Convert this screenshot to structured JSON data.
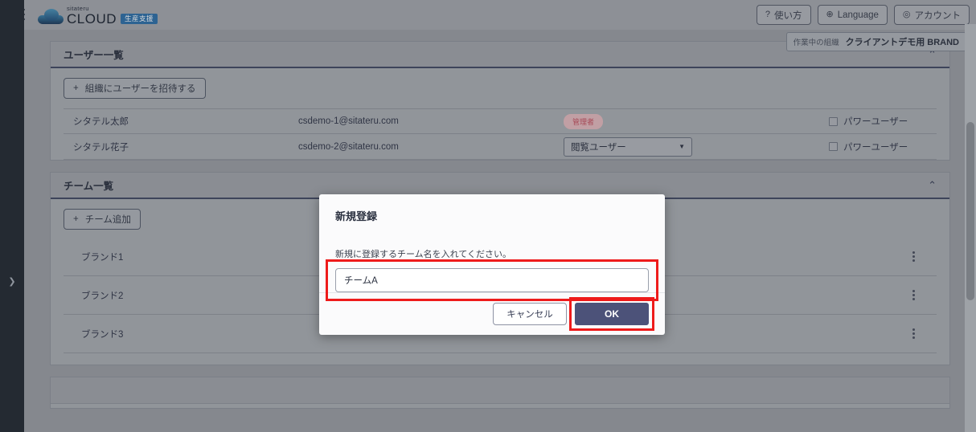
{
  "header": {
    "menu_icon": "hamburger-icon",
    "logo": {
      "brand": "sitateru",
      "product": "CLOUD",
      "badge": "生産支援"
    },
    "buttons": [
      {
        "icon": "question-circle-icon",
        "glyph": "?",
        "label": "使い方"
      },
      {
        "icon": "globe-icon",
        "glyph": "⊕",
        "label": "Language"
      },
      {
        "icon": "account-circle-icon",
        "glyph": "◎",
        "label": "アカウント"
      }
    ]
  },
  "org_pill": {
    "label": "作業中の組織",
    "value": "クライアントデモ用 BRAND"
  },
  "rail": {
    "toggle_icon": "chevron-right-icon",
    "toggle_glyph": "❯"
  },
  "user_panel": {
    "title": "ユーザー一覧",
    "collapse_icon": "chevron-up-icon",
    "collapse_glyph": "⌃",
    "invite_button": {
      "plus": "+",
      "label": "組織にユーザーを招待する"
    },
    "rows": [
      {
        "name": "シタテル太郎",
        "email": "csdemo-1@sitateru.com",
        "role_type": "badge",
        "role": "管理者",
        "power_user_label": "パワーユーザー",
        "power_user_checked": false
      },
      {
        "name": "シタテル花子",
        "email": "csdemo-2@sitateru.com",
        "role_type": "select",
        "role": "閲覧ユーザー",
        "power_user_label": "パワーユーザー",
        "power_user_checked": false
      }
    ]
  },
  "team_panel": {
    "title": "チーム一覧",
    "collapse_icon": "chevron-up-icon",
    "collapse_glyph": "⌃",
    "add_button": {
      "plus": "+",
      "label": "チーム追加"
    },
    "rows": [
      {
        "name": "ブランド1",
        "menu_icon": "kebab-menu-icon"
      },
      {
        "name": "ブランド2",
        "menu_icon": "kebab-menu-icon"
      },
      {
        "name": "ブランド3",
        "menu_icon": "kebab-menu-icon"
      }
    ]
  },
  "modal": {
    "title": "新規登録",
    "description": "新規に登録するチーム名を入れてください。",
    "input_value": "チームA",
    "input_placeholder": "",
    "cancel_label": "キャンセル",
    "ok_label": "OK",
    "highlight_color": "#ee1b1b",
    "primary_color": "#4c5279"
  },
  "colors": {
    "page_bg": "#9a9da3",
    "panel_bg": "#a9acb1",
    "rail_bg": "#242a33",
    "accent": "#4c5279",
    "badge_bg": "#e3b9bd",
    "badge_fg": "#c24f5f"
  }
}
